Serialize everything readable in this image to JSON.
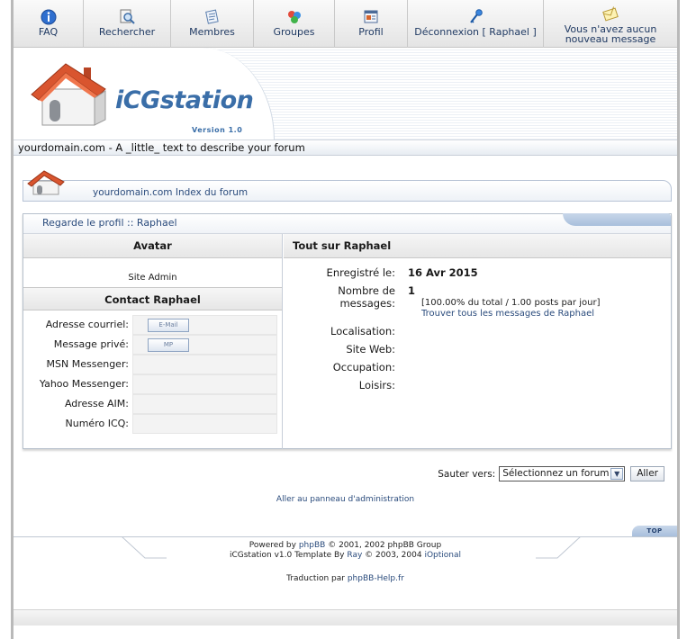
{
  "nav": {
    "items": [
      {
        "label": "FAQ",
        "icon": "info-icon"
      },
      {
        "label": "Rechercher",
        "icon": "search-icon"
      },
      {
        "label": "Membres",
        "icon": "members-icon"
      },
      {
        "label": "Groupes",
        "icon": "groups-icon"
      },
      {
        "label": "Profil",
        "icon": "profile-icon"
      },
      {
        "label": "Déconnexion [ Raphael ]",
        "icon": "key-icon"
      },
      {
        "label": "Vous n'avez aucun nouveau message",
        "icon": "message-icon"
      }
    ]
  },
  "banner": {
    "logo_text": "iCGstation",
    "version": "Version 1.0",
    "tagline": "yourdomain.com - A _little_ text to describe your forum"
  },
  "breadcrumb": {
    "link": "yourdomain.com Index du forum"
  },
  "profile": {
    "title": "Regarde le profil :: Raphael",
    "avatar_header": "Avatar",
    "rank": "Site Admin",
    "contact_header": "Contact Raphael",
    "contact": [
      {
        "label": "Adresse courriel:",
        "button": "E-Mail"
      },
      {
        "label": "Message privé:",
        "button": "MP"
      },
      {
        "label": "MSN Messenger:",
        "button": ""
      },
      {
        "label": "Yahoo Messenger:",
        "button": ""
      },
      {
        "label": "Adresse AIM:",
        "button": ""
      },
      {
        "label": "Numéro ICQ:",
        "button": ""
      }
    ],
    "about_header": "Tout sur Raphael",
    "registered_label": "Enregistré le:",
    "registered_value": "16 Avr 2015",
    "posts_label": "Nombre de messages:",
    "posts_value": "1",
    "posts_stats": "[100.00% du total / 1.00 posts par jour]",
    "posts_link": "Trouver tous les messages de Raphael",
    "location_label": "Localisation:",
    "website_label": "Site Web:",
    "occupation_label": "Occupation:",
    "interests_label": "Loisirs:"
  },
  "jump": {
    "label": "Sauter vers:",
    "selected": "Sélectionnez un forum",
    "go": "Aller"
  },
  "admin_link": "Aller au panneau d'administration",
  "footer": {
    "top": "TOP",
    "powered_prefix": "Powered by",
    "phpbb": "phpBB",
    "powered_suffix": "© 2001, 2002 phpBB Group",
    "template_prefix": "iCGstation v1.0 Template By",
    "ray": "Ray",
    "template_mid": "© 2003, 2004",
    "ioptional": "iOptional",
    "trad_prefix": "Traduction par",
    "trad_link": "phpBB-Help.fr"
  }
}
